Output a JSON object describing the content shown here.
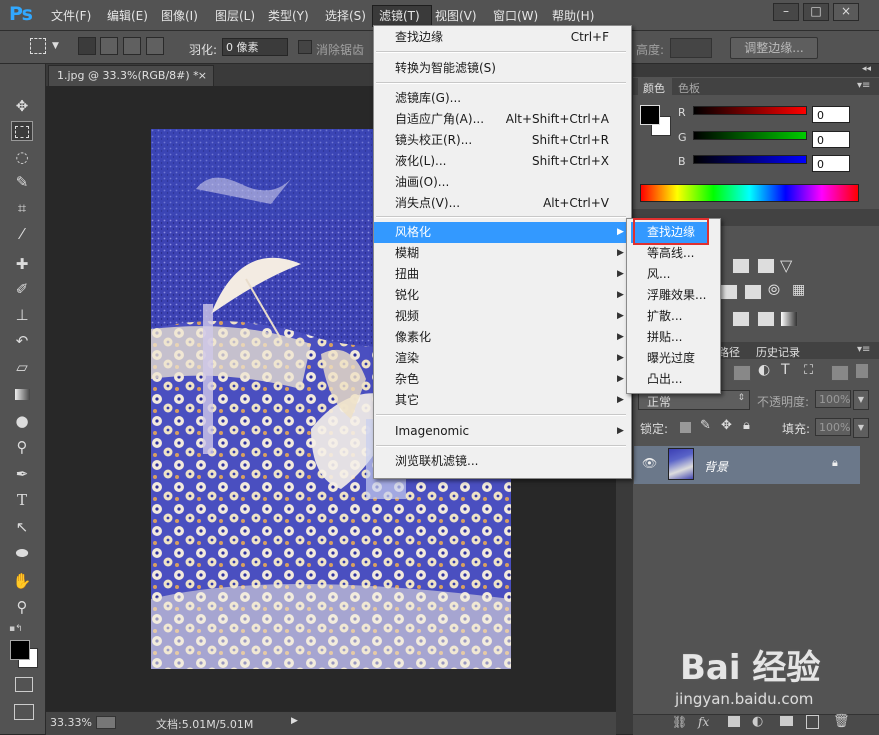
{
  "app": {
    "logo": "Ps",
    "menu": [
      "文件(F)",
      "编辑(E)",
      "图像(I)",
      "图层(L)",
      "类型(Y)",
      "选择(S)",
      "滤镜(T)",
      "视图(V)",
      "窗口(W)",
      "帮助(H)"
    ],
    "window_controls": [
      "–",
      "□",
      "×"
    ]
  },
  "options_bar": {
    "feather_label": "羽化:",
    "feather_value": "0 像素",
    "antialias_label": "消除锯齿",
    "height_label": "高度:",
    "refine_edge_button": "调整边缘..."
  },
  "document": {
    "tab_title": "1.jpg @ 33.3%(RGB/8#) *",
    "tab_close": "×",
    "zoom": "33.33%",
    "doc_size": "文档:5.01M/5.01M"
  },
  "filter_menu": {
    "items": [
      {
        "label": "查找边缘",
        "shortcut": "Ctrl+F"
      },
      {
        "label": "转换为智能滤镜(S)",
        "shortcut": ""
      },
      {
        "label": "滤镜库(G)...",
        "shortcut": ""
      },
      {
        "label": "自适应广角(A)...",
        "shortcut": "Alt+Shift+Ctrl+A"
      },
      {
        "label": "镜头校正(R)...",
        "shortcut": "Shift+Ctrl+R"
      },
      {
        "label": "液化(L)...",
        "shortcut": "Shift+Ctrl+X"
      },
      {
        "label": "油画(O)...",
        "shortcut": ""
      },
      {
        "label": "消失点(V)...",
        "shortcut": "Alt+Ctrl+V"
      },
      {
        "label": "风格化",
        "shortcut": ""
      },
      {
        "label": "模糊",
        "shortcut": ""
      },
      {
        "label": "扭曲",
        "shortcut": ""
      },
      {
        "label": "锐化",
        "shortcut": ""
      },
      {
        "label": "视频",
        "shortcut": ""
      },
      {
        "label": "像素化",
        "shortcut": ""
      },
      {
        "label": "渲染",
        "shortcut": ""
      },
      {
        "label": "杂色",
        "shortcut": ""
      },
      {
        "label": "其它",
        "shortcut": ""
      },
      {
        "label": "Imagenomic",
        "shortcut": ""
      },
      {
        "label": "浏览联机滤镜...",
        "shortcut": ""
      }
    ]
  },
  "stylize_submenu": {
    "items": [
      "查找边缘",
      "等高线...",
      "风...",
      "浮雕效果...",
      "扩散...",
      "拼贴...",
      "曝光过度",
      "凸出..."
    ]
  },
  "color_panel": {
    "tabs": [
      "颜色",
      "色板"
    ],
    "channels": [
      {
        "name": "R",
        "value": "0",
        "color": "#ff0000"
      },
      {
        "name": "G",
        "value": "0",
        "color": "#00c000"
      },
      {
        "name": "B",
        "value": "0",
        "color": "#0000ff"
      }
    ]
  },
  "layers_panel": {
    "tabs": [
      "路径",
      "历史记录"
    ],
    "blend_mode": "正常",
    "opacity_label": "不透明度:",
    "opacity_value": "100%",
    "lock_label": "锁定:",
    "fill_label": "填充:",
    "fill_value": "100%",
    "layer_name": "背景"
  },
  "watermark": {
    "brand": "Bai 经验",
    "url": "jingyan.baidu.com"
  }
}
